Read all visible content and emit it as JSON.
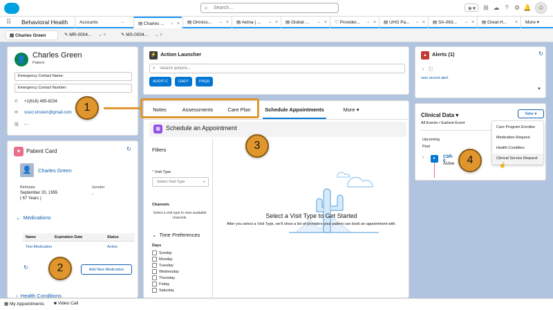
{
  "global": {
    "search_placeholder": "Search...",
    "icons": [
      "favorites-icon",
      "add-icon",
      "trailhead-icon",
      "help-icon",
      "settings-icon",
      "notifications-icon"
    ]
  },
  "nav": {
    "app_name": "Behavioral Health",
    "tabs": [
      {
        "label": "Accounts"
      },
      {
        "label": "Charles ..."
      },
      {
        "label": "Omnisc..."
      },
      {
        "label": "Aetna | ..."
      },
      {
        "label": "Global ..."
      },
      {
        "label": "Provider..."
      },
      {
        "label": "UHG Pa..."
      },
      {
        "label": "SA-063..."
      },
      {
        "label": "Great H..."
      },
      {
        "label": "More"
      }
    ]
  },
  "subtabs": [
    {
      "label": "Charles Green"
    },
    {
      "label": "MR-0004..."
    },
    {
      "label": "MS-0004..."
    }
  ],
  "patient": {
    "name": "Charles Green",
    "role": "Patient",
    "emergency_name_label": "Emergency Contact Name:",
    "emergency_number_label": "Emergency Contact Number:",
    "phone": "+1(618) 495-8234",
    "email": "sravz.kristem@gmail.com",
    "address": "- -"
  },
  "card": {
    "title": "Patient Card",
    "name": "Charles Green",
    "birthdate_label": "Birthdate",
    "birthdate": "September 20, 1955",
    "age": "( 67 Years )",
    "gender_label": "Gender",
    "gender": "-",
    "medications_label": "Medications",
    "med_headers": [
      "Name",
      "Expiration Date",
      "Status"
    ],
    "med_rows": [
      {
        "name": "Test Medication",
        "expiration": "",
        "status": "Active"
      }
    ],
    "add_med_label": "Add New Medication",
    "health_conditions_label": "Health Conditions"
  },
  "launcher": {
    "title": "Action Launcher",
    "search_placeholder": "Search actions...",
    "actions": [
      "AUDIT-C",
      "GAD7",
      "PHQ9"
    ]
  },
  "main_tabs": [
    {
      "label": "Notes"
    },
    {
      "label": "Assessments"
    },
    {
      "label": "Care Plan"
    },
    {
      "label": "Schedule Appointments"
    },
    {
      "label": "More"
    }
  ],
  "schedule": {
    "title": "Schedule an Appointment",
    "filters_label": "Filters",
    "visit_type_label": "Visit Type",
    "visit_type_placeholder": "Select Visit Type",
    "channels_label": "Channels",
    "channels_hint": "Select a visit type to view available channels.",
    "time_pref_label": "Time Preferences",
    "days_label": "Days",
    "days": [
      "Sunday",
      "Monday",
      "Tuesday",
      "Wednesday",
      "Thursday",
      "Friday",
      "Saturday"
    ],
    "empty_title": "Select a Visit Type to Get Started",
    "empty_desc": "After you select a Visit Type, we'll show a list of providers your patient can book an appointment with."
  },
  "alerts": {
    "title": "Alerts (1)",
    "link": "new record alert"
  },
  "clinical": {
    "title": "Clinical Data",
    "subtitle": "All Events • Earliest Event",
    "new_label": "New",
    "upcoming": "Upcoming",
    "past": "Past",
    "item_name": "CSR-0",
    "item_status": "Active",
    "menu": [
      "Care Program Enrollee",
      "Medication Request",
      "Health Condition",
      "Clinical Service Request"
    ]
  },
  "utility": {
    "appointments": "My Appointments",
    "video": "Video Call"
  },
  "callouts": [
    "1",
    "2",
    "3",
    "4"
  ],
  "colors": {
    "accent": "#0176d3",
    "callout": "#e0962d",
    "brand": "#00a1e0"
  }
}
